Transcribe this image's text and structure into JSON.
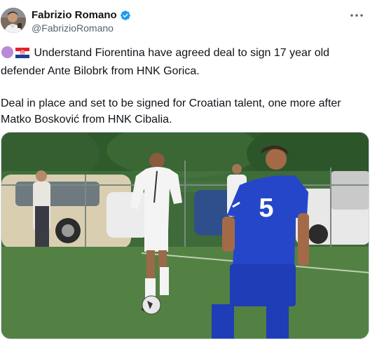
{
  "tweet": {
    "author": {
      "display_name": "Fabrizio Romano",
      "handle": "@FabrizioRomano",
      "verified": true,
      "verified_color": "#1d9bf0"
    },
    "more_icon": "more-horizontal-icon",
    "text": {
      "line1": "Understand Fiorentina have agreed deal to sign 17 year old",
      "line2": "defender Ante Bilobrk from HNK Gorica.",
      "line3": "Deal in place and set to be signed for Croatian talent, one more after",
      "line4": "Matko Bosković from HNK Cibalia."
    },
    "emojis": [
      "purple-circle-icon",
      "croatia-flag-icon"
    ],
    "media": {
      "player_numbers": [
        "5"
      ]
    }
  }
}
